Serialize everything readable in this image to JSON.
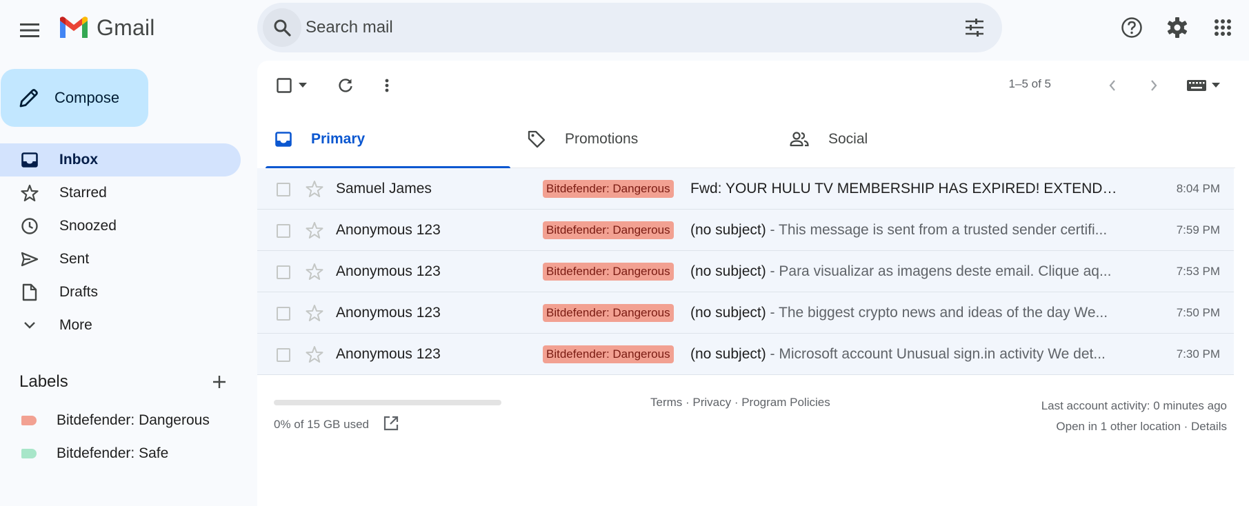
{
  "app": {
    "name": "Gmail"
  },
  "search": {
    "placeholder": "Search mail"
  },
  "compose": {
    "label": "Compose"
  },
  "nav": [
    {
      "label": "Inbox",
      "icon": "inbox-icon",
      "active": true
    },
    {
      "label": "Starred",
      "icon": "star-icon"
    },
    {
      "label": "Snoozed",
      "icon": "clock-icon"
    },
    {
      "label": "Sent",
      "icon": "send-icon"
    },
    {
      "label": "Drafts",
      "icon": "draft-icon"
    },
    {
      "label": "More",
      "icon": "chevron-down-icon"
    }
  ],
  "labels": {
    "title": "Labels",
    "items": [
      {
        "name": "Bitdefender: Dangerous",
        "color": "#f2a192"
      },
      {
        "name": "Bitdefender: Safe",
        "color": "#a8e6c9"
      }
    ]
  },
  "toolbar": {
    "page_info": "1–5 of 5"
  },
  "tabs": [
    {
      "label": "Primary",
      "icon": "inbox-icon",
      "active": true
    },
    {
      "label": "Promotions",
      "icon": "tag-icon"
    },
    {
      "label": "Social",
      "icon": "people-icon"
    }
  ],
  "emails": [
    {
      "sender": "Samuel James",
      "badge": "Bitdefender: Dangerous",
      "subject": "Fwd: YOUR HULU TV MEMBERSHIP HAS EXPIRED! EXTEND YOU...",
      "snippet": "",
      "time": "8:04 PM"
    },
    {
      "sender": "Anonymous 123",
      "badge": "Bitdefender: Dangerous",
      "subject": "(no subject)",
      "snippet": " - This message is sent from a trusted sender certifi...",
      "time": "7:59 PM"
    },
    {
      "sender": "Anonymous 123",
      "badge": "Bitdefender: Dangerous",
      "subject": "(no subject)",
      "snippet": " - Para visualizar as imagens deste email. Clique aq...",
      "time": "7:53 PM"
    },
    {
      "sender": "Anonymous 123",
      "badge": "Bitdefender: Dangerous",
      "subject": "(no subject)",
      "snippet": " - The biggest crypto news and ideas of the day We...",
      "time": "7:50 PM"
    },
    {
      "sender": "Anonymous 123",
      "badge": "Bitdefender: Dangerous",
      "subject": "(no subject)",
      "snippet": " - Microsoft account Unusual sign.in activity We det...",
      "time": "7:30 PM"
    }
  ],
  "footer": {
    "storage": "0% of 15 GB used",
    "storage_fraction": 0,
    "links": "Terms · Privacy · Program Policies",
    "activity": "Last account activity: 0 minutes ago",
    "locations": "Open in 1 other location · Details"
  },
  "colors": {
    "accent": "#0b57d0",
    "compose_bg": "#c2e7ff",
    "active_nav": "#d3e3fd",
    "danger_badge": "#f2a192"
  }
}
